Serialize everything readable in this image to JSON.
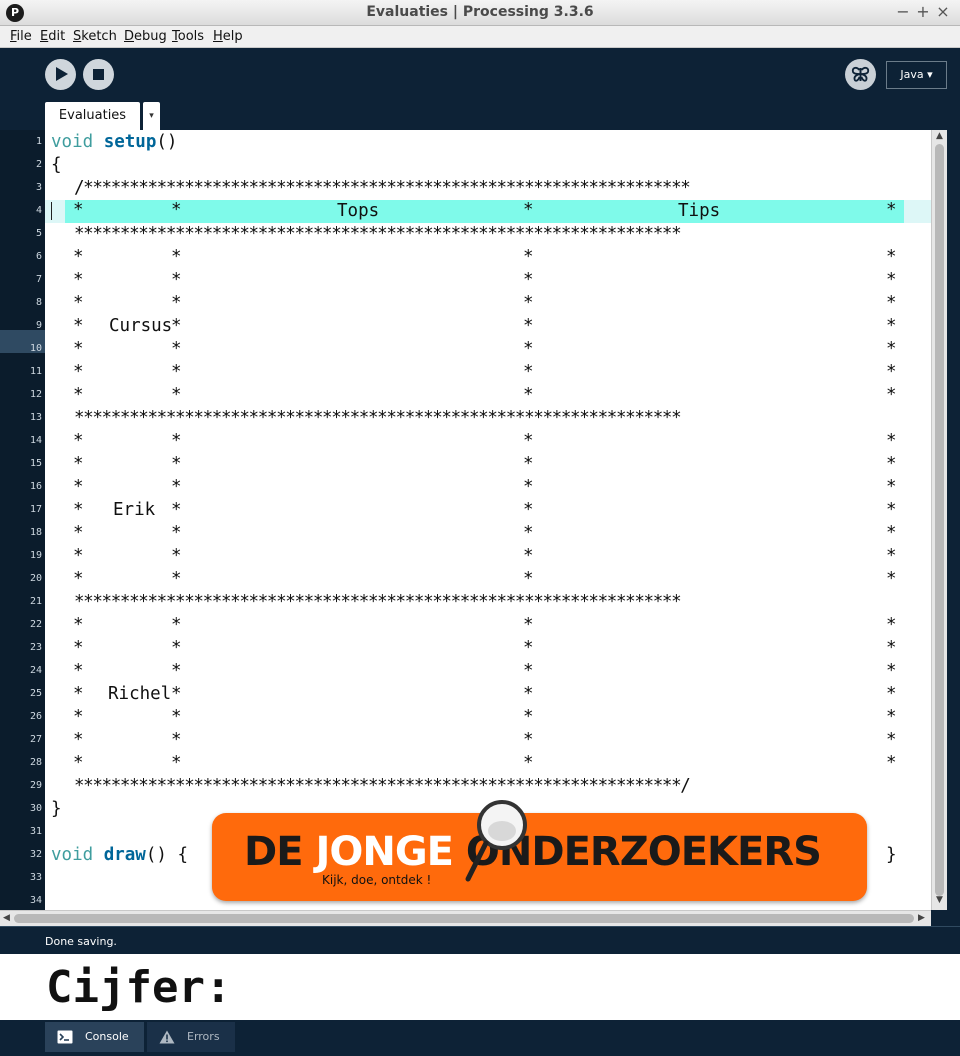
{
  "window": {
    "app_icon": "P",
    "title": "Evaluaties | Processing 3.3.6",
    "minimize": "−",
    "maximize": "+",
    "close": "×"
  },
  "menu": [
    {
      "hotkey": "F",
      "rest": "ile"
    },
    {
      "hotkey": "E",
      "rest": "dit"
    },
    {
      "hotkey": "S",
      "rest": "ketch"
    },
    {
      "hotkey": "D",
      "rest": "ebug"
    },
    {
      "hotkey": "T",
      "rest": "ools"
    },
    {
      "hotkey": "H",
      "rest": "elp"
    }
  ],
  "toolbar": {
    "run_icon": "play-icon",
    "stop_icon": "stop-icon",
    "debug_icon": "butterfly-icon",
    "mode": "Java ▾"
  },
  "tabs": {
    "active": "Evaluaties",
    "menu_arrow": "▾"
  },
  "editor": {
    "line_numbers": [
      "1",
      "2",
      "3",
      "4",
      "5",
      "6",
      "7",
      "8",
      "9",
      "10",
      "11",
      "12",
      "13",
      "14",
      "15",
      "16",
      "17",
      "18",
      "19",
      "20",
      "21",
      "22",
      "23",
      "24",
      "25",
      "26",
      "27",
      "28",
      "29",
      "30",
      "31",
      "32",
      "33",
      "34"
    ],
    "line1": {
      "kw": "void",
      "fn": "setup",
      "rest": "()"
    },
    "line2": "{",
    "line3": "/******************************************************************",
    "header": {
      "star": "*",
      "tops": "Tops",
      "tips": "Tips"
    },
    "star_row": "******************************************************************",
    "line29": "******************************************************************/",
    "line30": "}",
    "line32": {
      "kw": "void",
      "fn": "draw",
      "rest": "() {",
      "close": "}"
    },
    "names": [
      "Cursus",
      "Erik",
      "Richel"
    ],
    "star": "*"
  },
  "logo": {
    "part1": "DE ",
    "part2": "JONGE",
    "part3": " ONDERZOEKERS",
    "tagline": "Kijk, doe, ontdek !",
    "icon": "magnifier-icon"
  },
  "status": "Done saving.",
  "console": {
    "output": "Cijfer:"
  },
  "bottom_tabs": {
    "console": "Console",
    "errors": "Errors"
  }
}
